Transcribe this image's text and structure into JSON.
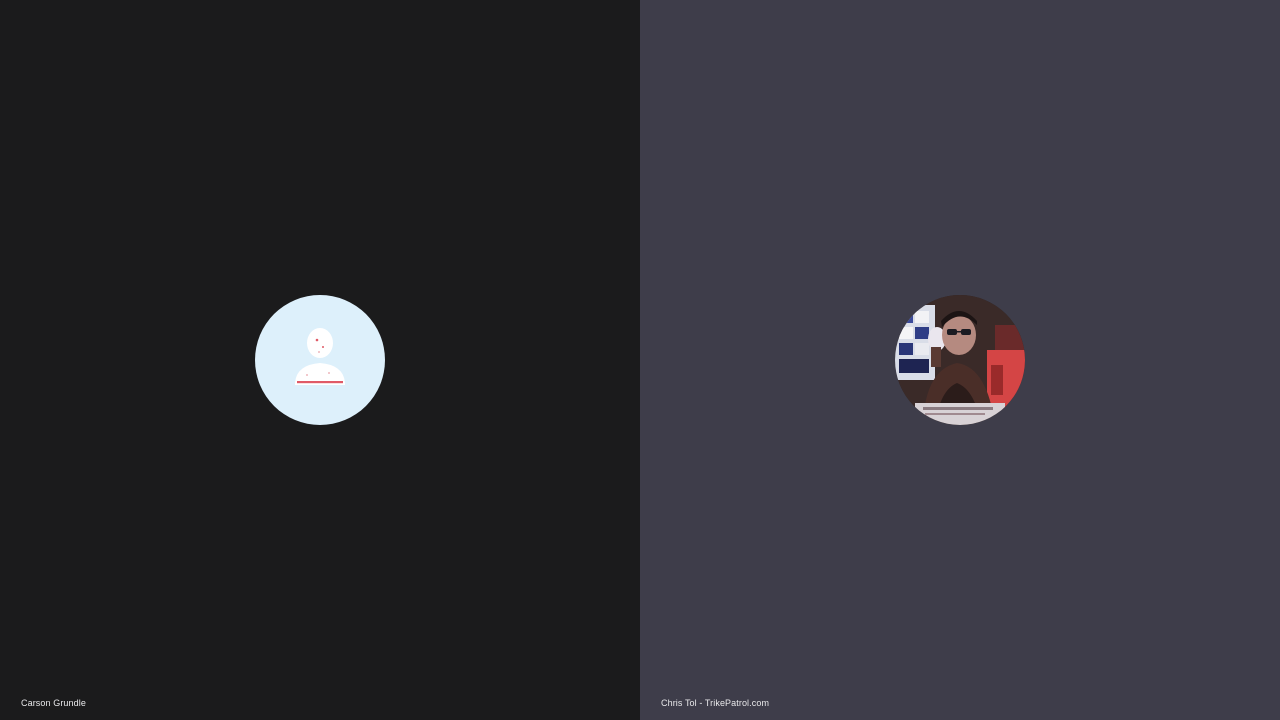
{
  "participants": [
    {
      "name": "Carson Grundle",
      "avatar_icon": "default-user-icon",
      "tile_color": "#1b1b1c",
      "avatar_bg": "#ddf0fb"
    },
    {
      "name": "Chris Tol - TrikePatrol.com",
      "avatar_icon": "user-photo-avatar",
      "tile_color": "#3e3d4a"
    }
  ]
}
